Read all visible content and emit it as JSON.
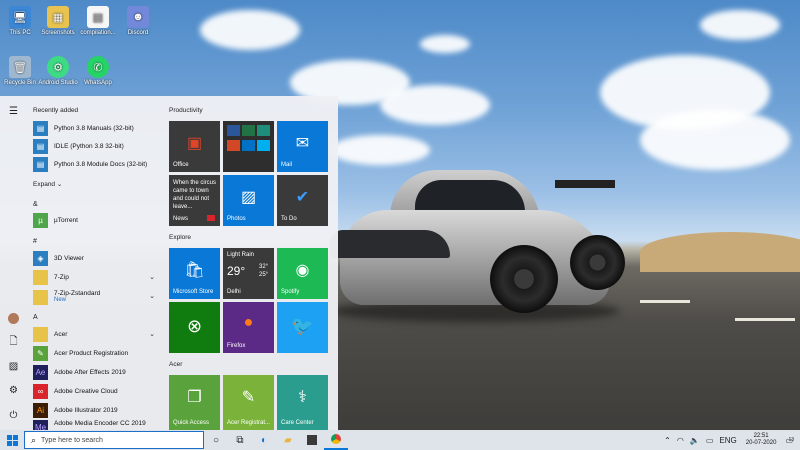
{
  "desktop": {
    "icons": [
      {
        "label": "This PC",
        "icon": "computer-icon"
      },
      {
        "label": "Screenshots",
        "icon": "folder-icon"
      },
      {
        "label": "compilation...",
        "icon": "file-icon"
      },
      {
        "label": "Discord",
        "icon": "discord-icon"
      },
      {
        "label": "Recycle Bin",
        "icon": "recycle-bin-icon"
      },
      {
        "label": "Android Studio",
        "icon": "android-studio-icon"
      },
      {
        "label": "WhatsApp",
        "icon": "whatsapp-icon"
      }
    ]
  },
  "start_menu": {
    "recently_added_label": "Recently added",
    "recent_items": [
      {
        "label": "Python 3.8 Manuals (32-bit)",
        "color": "#2b7fc1"
      },
      {
        "label": "IDLE (Python 3.8 32-bit)",
        "color": "#2b7fc1"
      },
      {
        "label": "Python 3.8 Module Docs (32-bit)",
        "color": "#2b7fc1"
      }
    ],
    "expand_label": "Expand",
    "sections": [
      {
        "letter": "&",
        "items": [
          {
            "label": "µTorrent",
            "color": "#4ea54a",
            "new": "",
            "chevron": false
          }
        ]
      },
      {
        "letter": "#",
        "items": [
          {
            "label": "3D Viewer",
            "color": "#2b7fc1",
            "new": "",
            "chevron": false
          }
        ]
      },
      {
        "letter": "",
        "items": [
          {
            "label": "7-Zip",
            "color": "#e8c34a",
            "new": "",
            "chevron": true
          },
          {
            "label": "7-Zip-Zstandard",
            "color": "#e8c34a",
            "new": "New",
            "chevron": true
          }
        ]
      },
      {
        "letter": "A",
        "items": [
          {
            "label": "Acer",
            "color": "#e8c34a",
            "new": "",
            "chevron": true
          },
          {
            "label": "Acer Product Registration",
            "color": "#5aa23c",
            "new": "",
            "chevron": false
          },
          {
            "label": "Adobe After Effects 2019",
            "color": "#1f1f5c",
            "new": "",
            "chevron": false
          },
          {
            "label": "Adobe Creative Cloud",
            "color": "#d8242a",
            "new": "",
            "chevron": false
          },
          {
            "label": "Adobe Illustrator 2019",
            "color": "#3b1d06",
            "new": "",
            "chevron": false
          },
          {
            "label": "Adobe Media Encoder CC 2019",
            "color": "#1f1f5c",
            "new": "",
            "chevron": false
          }
        ]
      }
    ],
    "groups": {
      "productivity": "Productivity",
      "explore": "Explore",
      "acer": "Acer"
    },
    "tiles": {
      "office": "Office",
      "mail": "Mail",
      "news": "News",
      "news_headline": "When the circus came to town and could not leave...",
      "photos": "Photos",
      "todo": "To Do",
      "store": "Microsoft Store",
      "weather_cond": "Light Rain",
      "weather_temp": "29°",
      "weather_hi": "32°",
      "weather_lo": "25°",
      "weather_city": "Delhi",
      "spotify": "Spotify",
      "firefox": "Firefox",
      "quick_access": "Quick Access",
      "acer_reg": "Acer Registrat...",
      "care_center": "Care Center"
    }
  },
  "taskbar": {
    "search_placeholder": "Type here to search",
    "lang": "ENG",
    "time": "22:51",
    "date": "20-07-2020",
    "notif_count": "13"
  }
}
